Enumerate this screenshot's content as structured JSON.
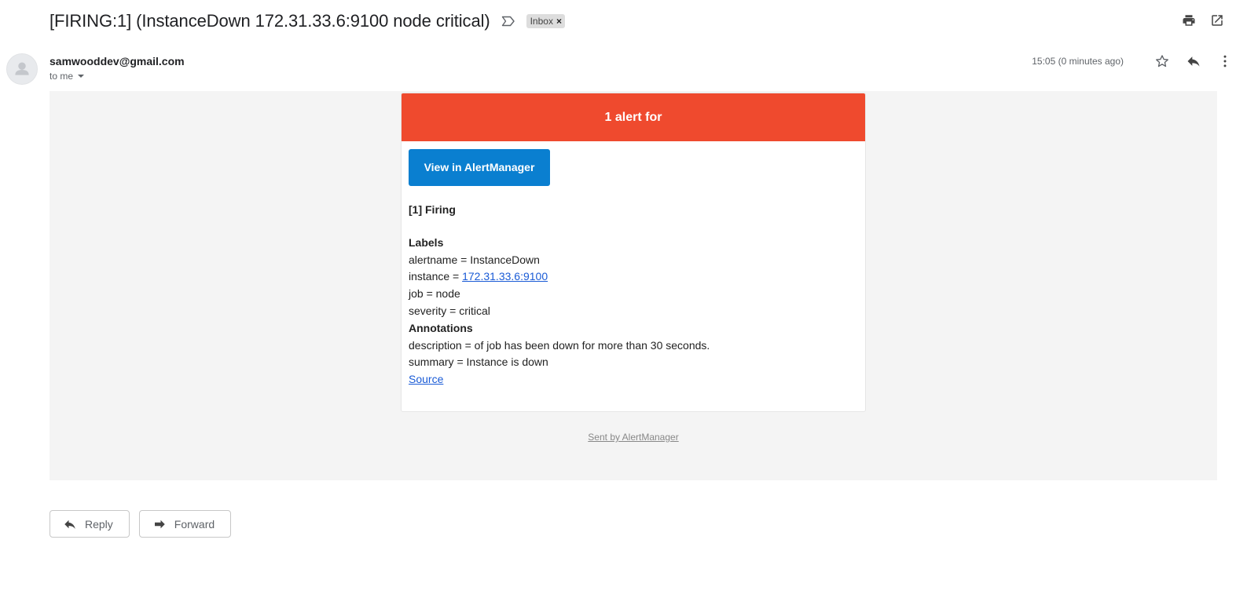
{
  "subject": {
    "title": "[FIRING:1] (InstanceDown 172.31.33.6:9100 node critical)",
    "label_chip": "Inbox",
    "label_remove": "×"
  },
  "top_actions": {
    "print_icon": "print-icon",
    "popout_icon": "open-in-new-window-icon"
  },
  "sender": {
    "email": "samwooddev@gmail.com",
    "recipient_line": "to me",
    "time": "15:05 (0 minutes ago)"
  },
  "message": {
    "header": "1 alert for",
    "button_label": "View in AlertManager",
    "firing_title": "[1] Firing",
    "labels_title": "Labels",
    "labels": [
      {
        "prefix": "alertname = ",
        "value": "InstanceDown"
      },
      {
        "prefix": "instance = ",
        "value": "172.31.33.6:9100"
      },
      {
        "prefix": "job = ",
        "value": "node"
      },
      {
        "prefix": "severity = ",
        "value": "critical"
      }
    ],
    "annotations_title": "Annotations",
    "annotations": [
      {
        "text": "description = of job has been down for more than 30 seconds."
      },
      {
        "text": "summary = Instance is down"
      }
    ],
    "source_link": "Source",
    "footer": "Sent by AlertManager"
  },
  "actions": {
    "reply": "Reply",
    "forward": "Forward"
  },
  "colors": {
    "alert_header": "#ef4a2e",
    "button": "#0a7fd0",
    "link": "#1a5bd6",
    "canvas": "#f4f4f4"
  }
}
